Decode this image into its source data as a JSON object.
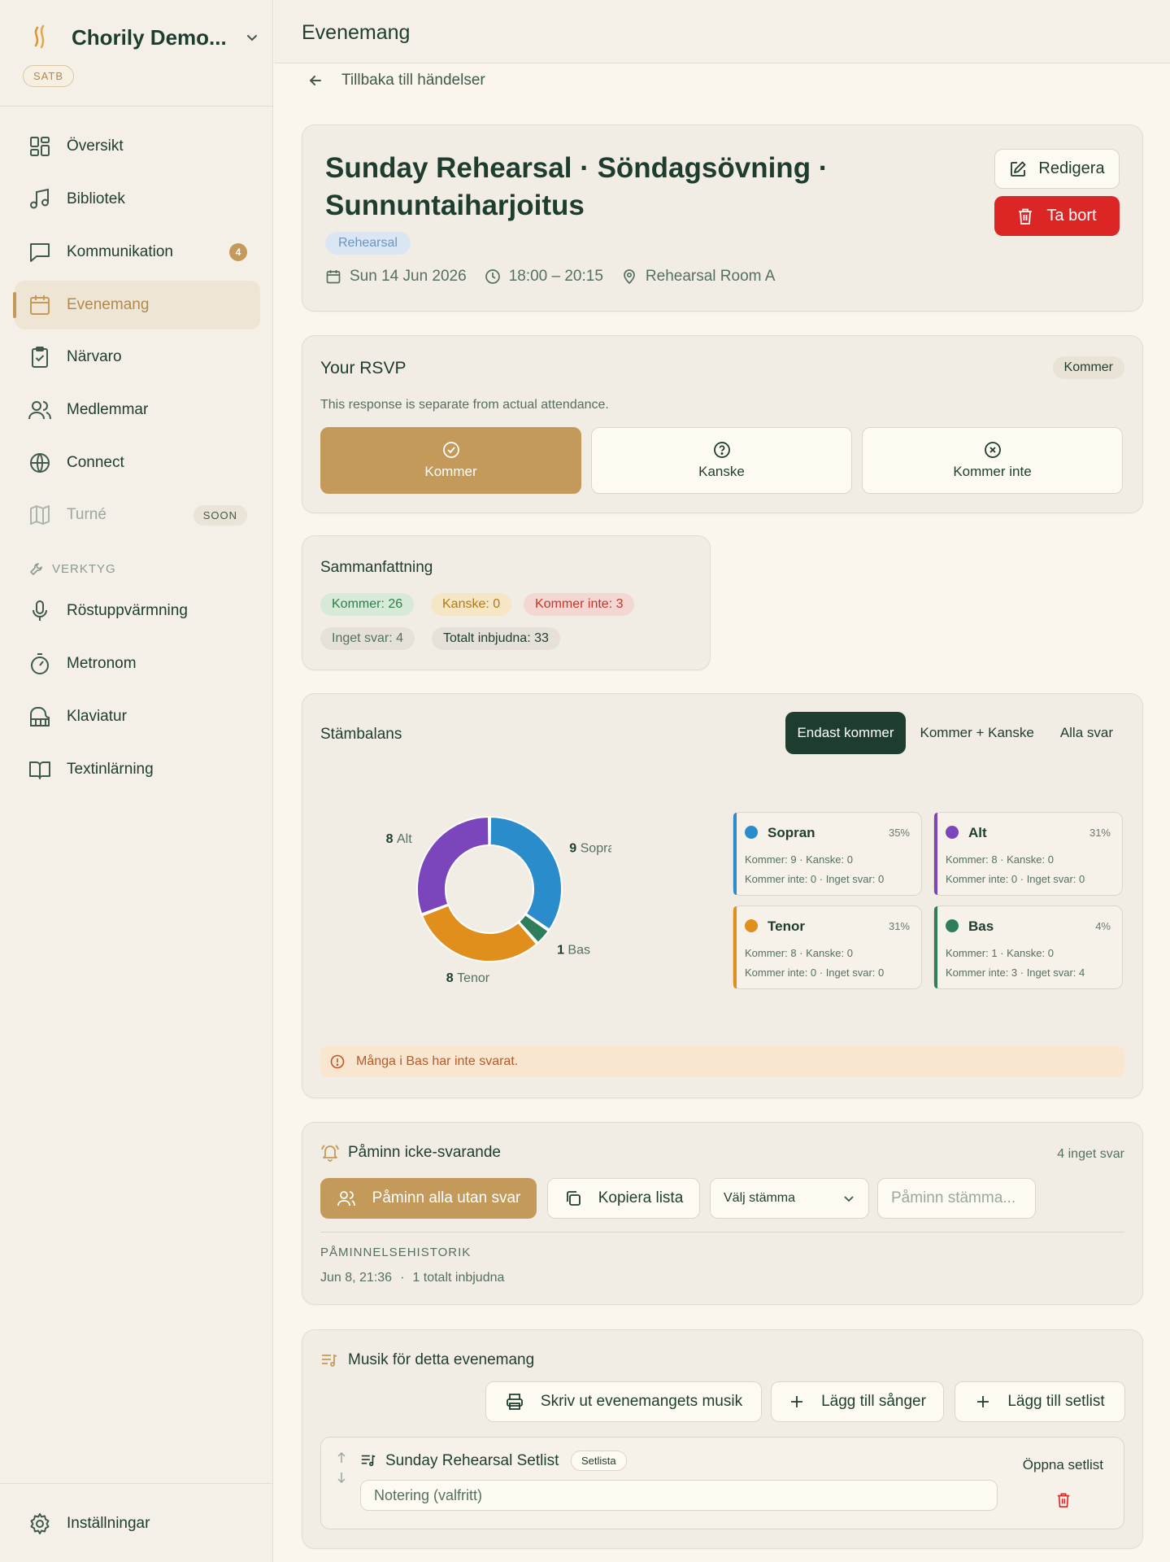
{
  "sidebar": {
    "org_name": "Chorily Demo...",
    "org_type": "SATB",
    "items": [
      {
        "label": "Översikt"
      },
      {
        "label": "Bibliotek"
      },
      {
        "label": "Kommunikation",
        "badge": "4"
      },
      {
        "label": "Evenemang"
      },
      {
        "label": "Närvaro"
      },
      {
        "label": "Medlemmar"
      },
      {
        "label": "Connect"
      },
      {
        "label": "Turné",
        "badge": "SOON"
      }
    ],
    "tools_label": "VERKTYG",
    "tools": [
      {
        "label": "Röstuppvärmning"
      },
      {
        "label": "Metronom"
      },
      {
        "label": "Klaviatur"
      },
      {
        "label": "Textinlärning"
      }
    ],
    "settings_label": "Inställningar"
  },
  "header": {
    "title": "Evenemang",
    "back_label": "Tillbaka till händelser"
  },
  "event": {
    "title": "Sunday Rehearsal · Söndagsövning · Sunnuntaiharjoitus",
    "type": "Rehearsal",
    "date": "Sun 14 Jun 2026",
    "time": "18:00 – 20:15",
    "location": "Rehearsal Room A",
    "edit_label": "Redigera",
    "delete_label": "Ta bort"
  },
  "rsvp": {
    "title": "Your RSVP",
    "status": "Kommer",
    "note": "This response is separate from actual attendance.",
    "options": [
      "Kommer",
      "Kanske",
      "Kommer inte"
    ],
    "selected": "Kommer"
  },
  "summary": {
    "title": "Sammanfattning",
    "coming": "Kommer: 26",
    "maybe": "Kanske: 0",
    "not_coming": "Kommer inte: 3",
    "no_answer": "Inget svar: 4",
    "total": "Totalt inbjudna: 33"
  },
  "balance": {
    "title": "Stämbalans",
    "filters": [
      "Endast kommer",
      "Kommer + Kanske",
      "Alla svar"
    ],
    "active_filter": "Endast kommer",
    "warning": "Många i Bas har inte svarat.",
    "voices": [
      {
        "name": "Sopran",
        "count": "9",
        "pct": "35%",
        "line1": "Kommer: 9 · Kanske: 0",
        "line2": "Kommer inte: 0 · Inget svar: 0",
        "color": "#2b8ccb"
      },
      {
        "name": "Alt",
        "count": "8",
        "pct": "31%",
        "line1": "Kommer: 8 · Kanske: 0",
        "line2": "Kommer inte: 0 · Inget svar: 0",
        "color": "#7b45bb"
      },
      {
        "name": "Tenor",
        "count": "8",
        "pct": "31%",
        "line1": "Kommer: 8 · Kanske: 0",
        "line2": "Kommer inte: 0 · Inget svar: 0",
        "color": "#e08f1d"
      },
      {
        "name": "Bas",
        "count": "1",
        "pct": "4%",
        "line1": "Kommer: 1 · Kanske: 0",
        "line2": "Kommer inte: 3 · Inget svar: 4",
        "color": "#2f7d5a"
      }
    ]
  },
  "chart_data": {
    "type": "pie",
    "donut": true,
    "categories": [
      "Sopran",
      "Bas",
      "Tenor",
      "Alt"
    ],
    "values": [
      9,
      1,
      8,
      8
    ],
    "colors": [
      "#2b8ccb",
      "#2f7d5a",
      "#e08f1d",
      "#7b45bb"
    ]
  },
  "reminder": {
    "title": "Påminn icke-svarande",
    "count": "4 inget svar",
    "remind_all": "Påminn alla utan svar",
    "copy_list": "Kopiera lista",
    "select_voice": "Välj stämma",
    "remind_voice": "Påminn stämma...",
    "history_label": "PÅMINNELSEHISTORIK",
    "history": [
      {
        "date": "Jun 8, 21:36",
        "sep": "·",
        "text": "1 totalt inbjudna"
      }
    ]
  },
  "music": {
    "title": "Musik för detta evenemang",
    "print_label": "Skriv ut evenemangets musik",
    "add_songs": "Lägg till sånger",
    "add_setlist": "Lägg till setlist",
    "setlist_name": "Sunday Rehearsal Setlist",
    "setlist_badge": "Setlista",
    "open_setlist": "Öppna setlist",
    "note_placeholder": "Notering (valfritt)"
  }
}
